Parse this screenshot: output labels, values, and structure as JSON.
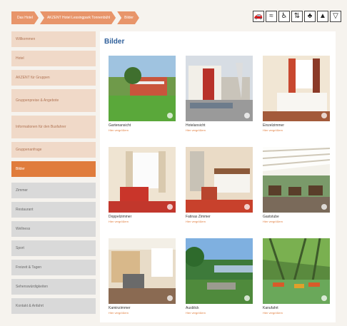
{
  "breadcrumb": [
    {
      "label": "Das Hotel"
    },
    {
      "label": "AKZENT Hotel Lessingpark Tonnenbühl"
    },
    {
      "label": "Bilder"
    }
  ],
  "amenity_icons": [
    "car-icon",
    "wifi-icon",
    "wheelchair-icon",
    "elevator-icon",
    "pet-icon",
    "water-icon",
    "cocktail-icon"
  ],
  "sidebar": {
    "items": [
      {
        "label": "Willkommen",
        "state": "normal"
      },
      {
        "label": "Hotel",
        "state": "normal"
      },
      {
        "label": "AKZENT für Gruppen",
        "state": "normal"
      },
      {
        "label": "Gruppenpreise & Angebote",
        "state": "normal"
      },
      {
        "label": "Informationen für den Busfahrer",
        "state": "normal"
      },
      {
        "label": "Gruppenanfrage",
        "state": "normal"
      },
      {
        "label": "Bilder",
        "state": "active"
      },
      {
        "label": "Zimmer",
        "state": "grey"
      },
      {
        "label": "Restaurant",
        "state": "grey"
      },
      {
        "label": "Wellness",
        "state": "grey"
      },
      {
        "label": "Sport",
        "state": "grey"
      },
      {
        "label": "Freizeit & Tagen",
        "state": "grey"
      },
      {
        "label": "Sehenswürdigkeiten",
        "state": "grey"
      },
      {
        "label": "Kontakt & Anfahrt",
        "state": "grey"
      }
    ]
  },
  "main": {
    "title": "Bilder",
    "gallery": [
      {
        "caption": "Gartenansicht",
        "sub": "Hier vergrößern",
        "scene": "garden"
      },
      {
        "caption": "Hotelansicht",
        "sub": "Hier vergrößern",
        "scene": "building"
      },
      {
        "caption": "Einzelzimmer",
        "sub": "Hier vergrößern",
        "scene": "room1"
      },
      {
        "caption": "Doppelzimmer",
        "sub": "Hier vergrößern",
        "scene": "room2"
      },
      {
        "caption": "Fatinas Zimmer",
        "sub": "Hier vergrößern",
        "scene": "room3"
      },
      {
        "caption": "Gaststube",
        "sub": "Hier vergrößern",
        "scene": "dining"
      },
      {
        "caption": "Kaminzimmer",
        "sub": "Hier vergrößern",
        "scene": "hall"
      },
      {
        "caption": "Ausblick",
        "sub": "Hier vergrößern",
        "scene": "view"
      },
      {
        "caption": "Kanufahrt",
        "sub": "Hier vergrößern",
        "scene": "canoe"
      }
    ]
  },
  "colors": {
    "accent": "#e07c3c",
    "title": "#2f5f9a",
    "side_bg": "#f0d9c8",
    "side_grey": "#d9d9d9"
  }
}
